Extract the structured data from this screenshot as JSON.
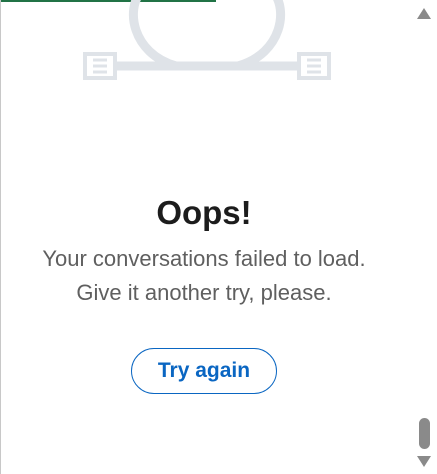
{
  "colors": {
    "accent": "#0a66c2",
    "top_bar": "#217346",
    "illustration": "#dfe3e8",
    "title": "#1c1c1c",
    "body_text": "#5f5f5f"
  },
  "illustration": {
    "icon": "disconnected-cable-icon"
  },
  "error": {
    "title": "Oops!",
    "line1": "Your conversations failed to load.",
    "line2": "Give it another try, please."
  },
  "actions": {
    "retry_label": "Try again"
  },
  "scrollbar": {
    "up_icon": "scroll-up-arrow-icon",
    "down_icon": "scroll-down-arrow-icon"
  }
}
